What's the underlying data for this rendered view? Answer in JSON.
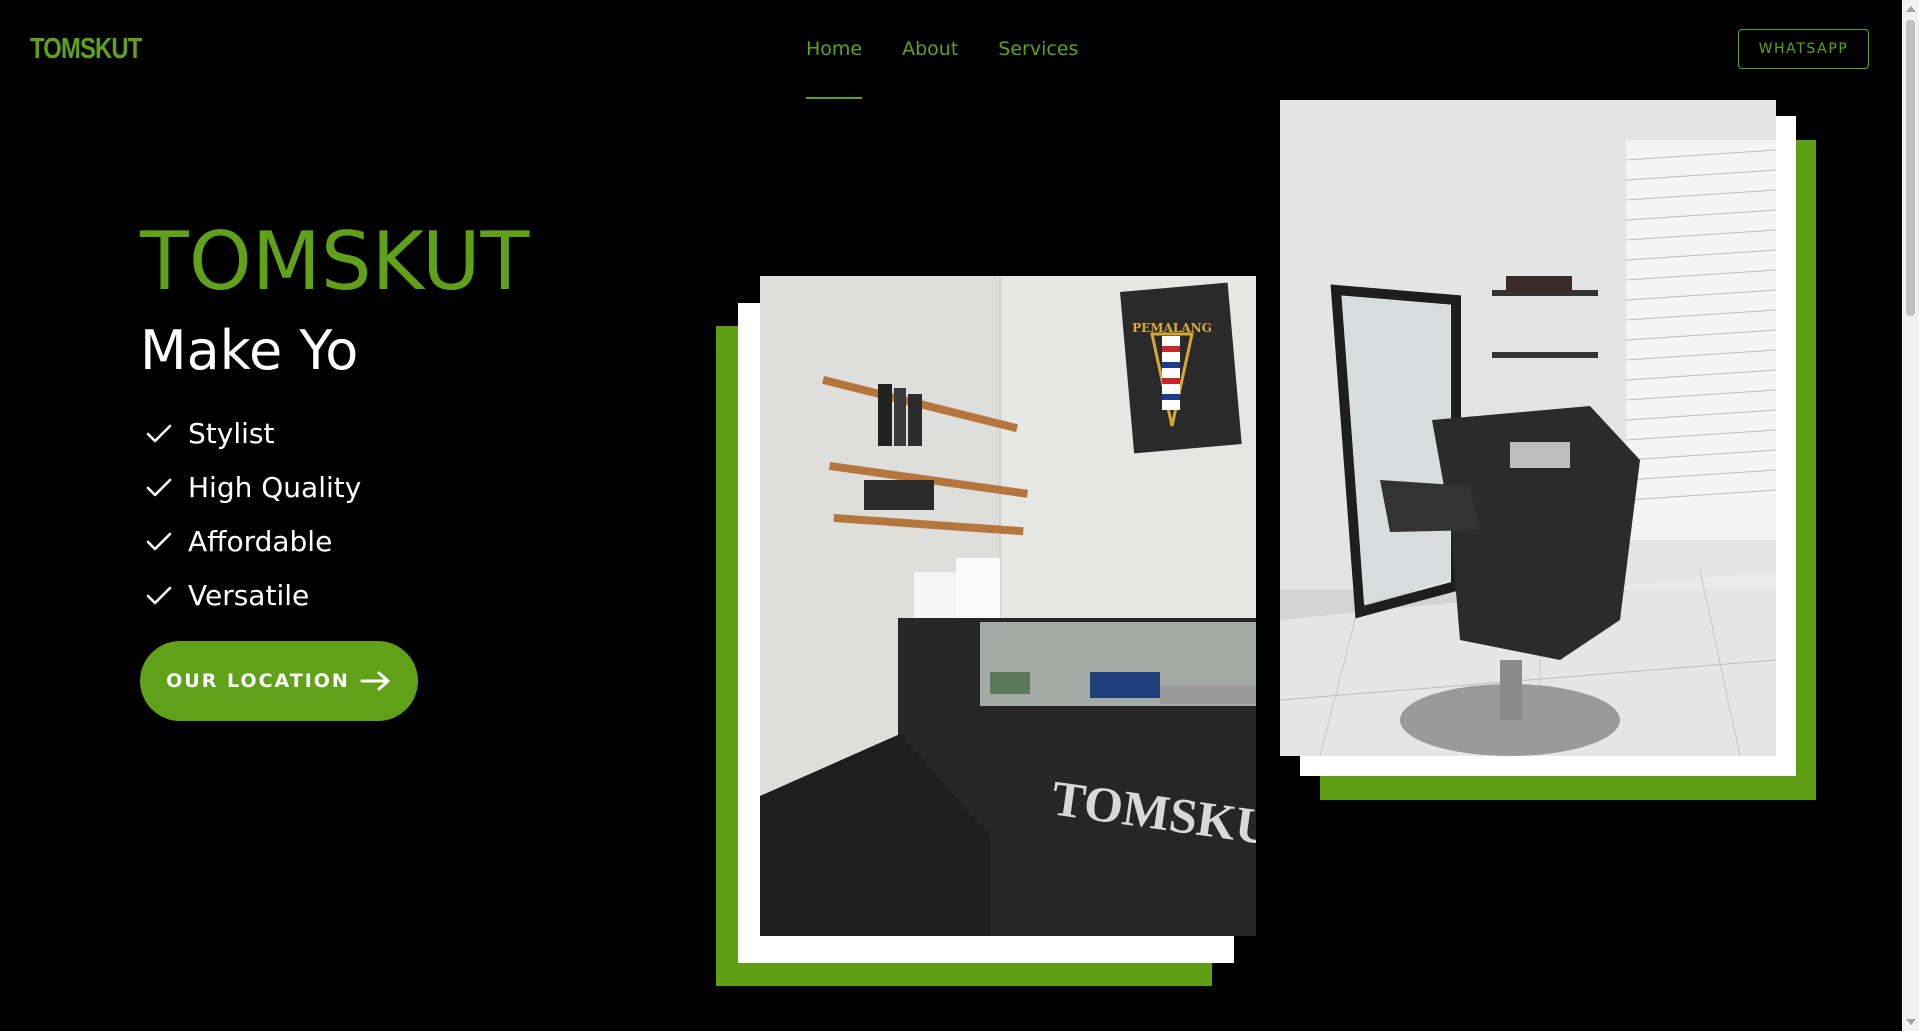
{
  "brand": {
    "logo": "TOMSKUT"
  },
  "nav": {
    "items": [
      {
        "label": "Home",
        "active": true
      },
      {
        "label": "About"
      },
      {
        "label": "Services"
      }
    ]
  },
  "header": {
    "whatsapp_label": "WHATSAPP"
  },
  "hero": {
    "title": "TOMSKUT",
    "subtitle": "Make Yo",
    "features": [
      "Stylist",
      "High Quality",
      "Affordable",
      "Versatile"
    ],
    "cta_label": "OUR LOCATION"
  },
  "photos": {
    "counter_sign_text": "TOMSKUT",
    "poster_text": "PEMALANG"
  },
  "colors": {
    "accent": "#61a11a",
    "background": "#000000",
    "text": "#ffffff"
  },
  "icons": {
    "feature": "check-icon",
    "cta": "arrow-right-icon"
  }
}
